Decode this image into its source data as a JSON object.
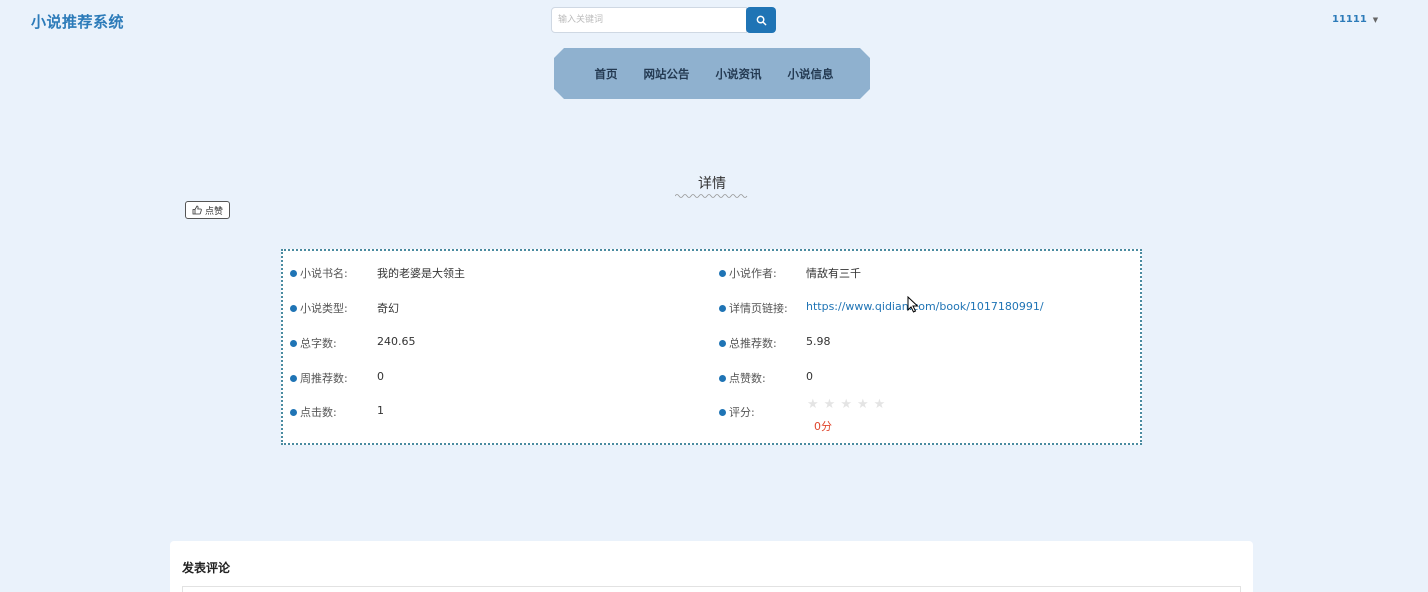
{
  "header": {
    "brand": "小说推荐系统",
    "search_placeholder": "输入关键词",
    "user_name": "11111"
  },
  "nav": {
    "items": [
      {
        "label": "首页"
      },
      {
        "label": "网站公告"
      },
      {
        "label": "小说资讯"
      },
      {
        "label": "小说信息"
      }
    ]
  },
  "detail": {
    "title": "详情",
    "like_label": "点赞"
  },
  "info": {
    "book_name_label": "小说书名:",
    "book_name": "我的老婆是大领主",
    "author_label": "小说作者:",
    "author": "情敌有三千",
    "type_label": "小说类型:",
    "type": "奇幻",
    "link_label": "详情页链接:",
    "link": "https://www.qidian.com/book/1017180991/",
    "total_words_label": "总字数:",
    "total_words": "240.65",
    "total_recommend_label": "总推荐数:",
    "total_recommend": "5.98",
    "weekly_recommend_label": "周推荐数:",
    "weekly_recommend": "0",
    "likes_label": "点赞数:",
    "likes": "0",
    "clicks_label": "点击数:",
    "clicks": "1",
    "rating_label": "评分:",
    "rating_score": "0分",
    "rating_stars": 0,
    "rating_max": 5
  },
  "comments": {
    "title": "发表评论"
  },
  "colors": {
    "accent": "#1f74b5",
    "brand": "#2c7bb9",
    "nav_bg": "#8fb1cf",
    "page_bg": "#eaf2fb",
    "score_red": "#e0462d"
  }
}
